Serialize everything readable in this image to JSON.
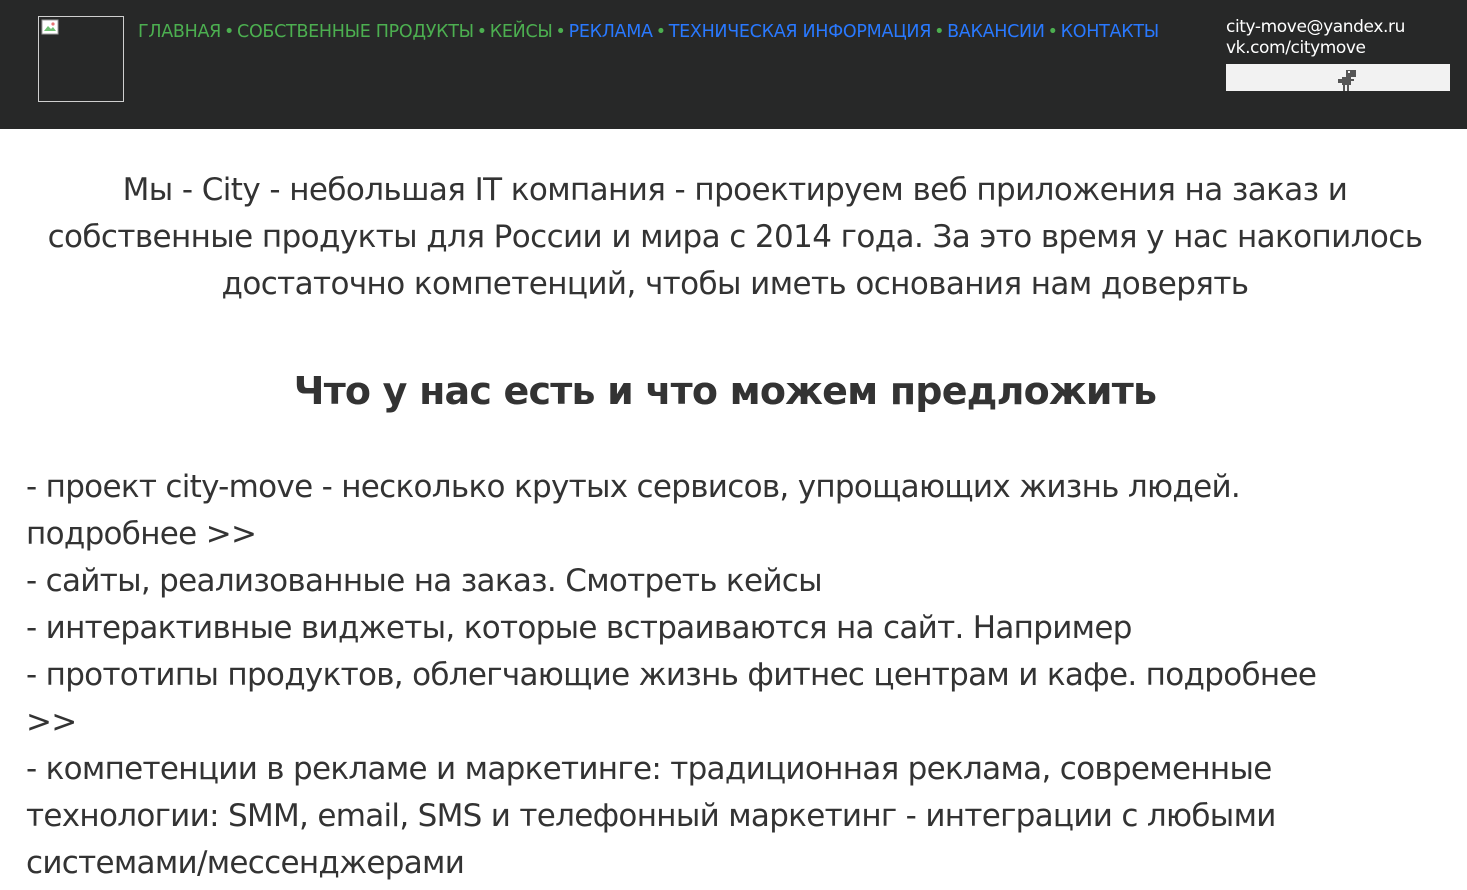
{
  "header": {
    "logo_icon": "broken-image-icon",
    "nav": [
      {
        "label": "ГЛАВНАЯ",
        "color": "#4caf50"
      },
      {
        "label": "СОБСТВЕННЫЕ ПРОДУКТЫ",
        "color": "#4caf50"
      },
      {
        "label": "КЕЙСЫ",
        "color": "#4caf50"
      },
      {
        "label": "РЕКЛАМА",
        "color": "#2979ff"
      },
      {
        "label": "ТЕХНИЧЕСКАЯ ИНФОРМАЦИЯ",
        "color": "#2979ff"
      },
      {
        "label": "ВАКАНСИИ",
        "color": "#2979ff"
      },
      {
        "label": "КОНТАКТЫ",
        "color": "#2979ff"
      }
    ],
    "separator": "•",
    "contacts": {
      "email": "city-move@yandex.ru",
      "vk": "vk.com/citymove"
    },
    "widget_icon": "dino-icon"
  },
  "main": {
    "intro": "Мы - City - небольшая IT компания - проектируем веб приложения на заказ и собственные продукты для России и мира с 2014 года. За это время у нас накопилось достаточно компетенций, чтобы иметь основания нам доверять",
    "heading": "Что у нас есть и что можем предложить",
    "offers": [
      "- проект city-move - несколько крутых сервисов, упрощающих жизнь людей.",
      "подробнее >>",
      "- сайты, реализованные на заказ. Смотреть кейсы",
      "- интерактивные виджеты, которые встраиваются на сайт. Например",
      "- прототипы продуктов, облегчающие жизнь фитнес центрам и кафе. подробнее",
      ">>",
      "- компетенции в рекламе и маркетинге: традиционная реклама, современные",
      "технологии: SMM, email, SMS и телефонный маркетинг - интеграции с любыми",
      "системами/мессенджерами"
    ]
  }
}
